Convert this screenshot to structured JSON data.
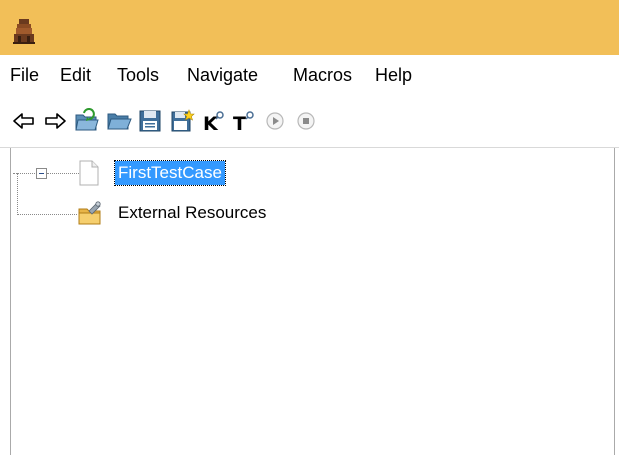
{
  "menu": {
    "items": [
      "File",
      "Edit",
      "Tools",
      "Navigate",
      "Macros",
      "Help"
    ]
  },
  "toolbar": {
    "icons": [
      "back-arrow-icon",
      "forward-arrow-icon",
      "open-folder-refresh-icon",
      "open-folder-icon",
      "save-icon",
      "save-all-icon",
      "find-keyword-icon",
      "find-testcase-icon",
      "run-icon",
      "stop-icon"
    ]
  },
  "tree": {
    "nodes": [
      {
        "label": "FirstTestCase",
        "selected": true,
        "icon": "document-icon"
      },
      {
        "label": "External Resources",
        "selected": false,
        "icon": "folder-tool-icon"
      }
    ]
  },
  "colors": {
    "titlebar": "#f2bf58",
    "selection": "#3399ff"
  }
}
